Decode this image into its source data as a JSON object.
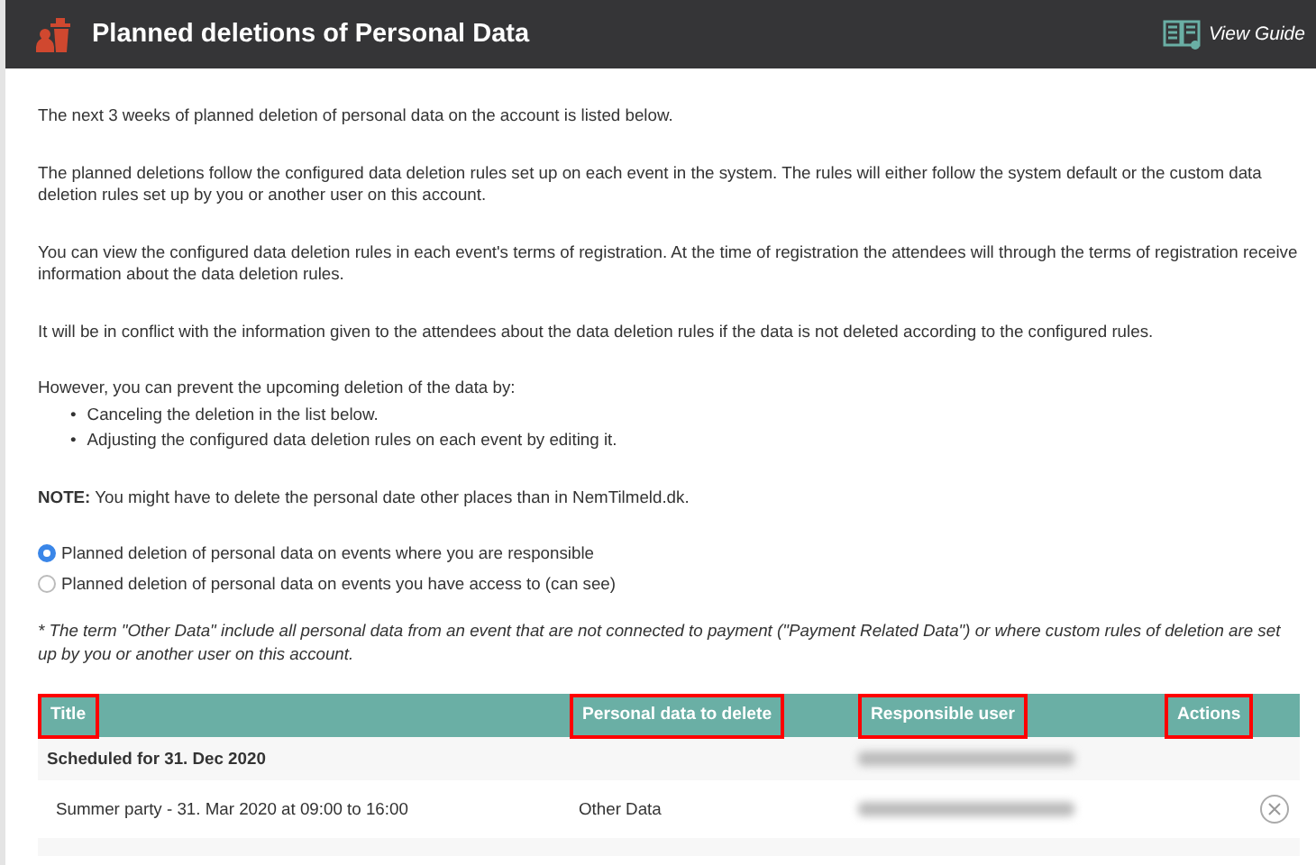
{
  "header": {
    "title": "Planned deletions of Personal Data",
    "guide_link": "View Guide"
  },
  "intro": [
    "The next 3 weeks of planned deletion of personal data on the account is listed below.",
    "The planned deletions follow the configured data deletion rules set up on each event in the system. The rules will either follow the system default or the custom data deletion rules set up by you or another user on this account.",
    "You can view the configured data deletion rules in each event's terms of registration. At the time of registration the attendees will through the terms of registration receive information about the data deletion rules.",
    "It will be in conflict with the information given to the attendees about the data deletion rules if the data is not deleted according to the configured rules."
  ],
  "prevent": {
    "text": "However, you can prevent the upcoming deletion of the data by:",
    "bullets": [
      {
        "marker": "•",
        "text": "Canceling the deletion in the list below."
      },
      {
        "marker": "•",
        "text": "Adjusting the configured data deletion rules on each event by editing it."
      }
    ]
  },
  "note": "**NOTE:** You might have to delete the personal date other places than in NemTilmeld.dk.",
  "filters": [
    {
      "label": "Planned deletion of personal data on events where you are responsible",
      "selected": true
    },
    {
      "label": "Planned deletion of personal data on events you have access to (can see)",
      "selected": false
    }
  ],
  "footnote": "* The term \"Other Data\" include all personal data from an event that are not connected to payment (\"Payment Related Data\") or where custom rules of deletion are set up by you or another user on this account.",
  "table": {
    "columns": [
      {
        "label": "Title",
        "highlighted": true
      },
      {
        "label": "Personal data to delete",
        "highlighted": true
      },
      {
        "label": "Responsible user",
        "highlighted": true
      },
      {
        "label": "Actions",
        "highlighted": true
      }
    ],
    "groups": [
      {
        "title": "Scheduled for 31. Dec 2020",
        "rows": [
          {
            "title": "Summer party - 31. Mar 2020 at 09:00 to 16:00",
            "data": "Other Data"
          }
        ]
      }
    ]
  }
}
